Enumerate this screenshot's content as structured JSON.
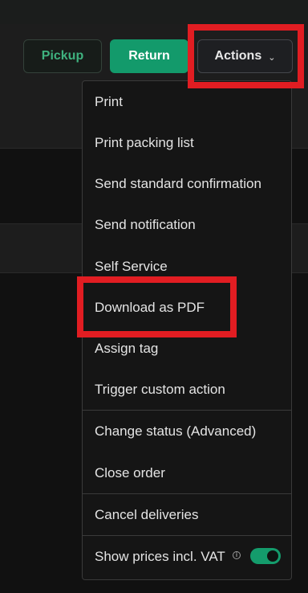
{
  "toolbar": {
    "pickup_label": "Pickup",
    "return_label": "Return",
    "actions_label": "Actions",
    "actions_chevron": "⌵"
  },
  "menu": {
    "items": [
      {
        "label": "Print"
      },
      {
        "label": "Print packing list"
      },
      {
        "label": "Send standard confirmation"
      },
      {
        "label": "Send notification"
      },
      {
        "label": "Self Service"
      },
      {
        "label": "Download as PDF"
      },
      {
        "label": "Assign tag"
      },
      {
        "label": "Trigger custom action"
      },
      {
        "label": "Change status (Advanced)"
      },
      {
        "label": "Close order"
      },
      {
        "label": "Cancel deliveries"
      }
    ],
    "vat_toggle": {
      "label": "Show prices incl. VAT",
      "info_icon": "i",
      "enabled": true
    }
  },
  "colors": {
    "accent": "#149c6c",
    "highlight": "#e11d22"
  }
}
